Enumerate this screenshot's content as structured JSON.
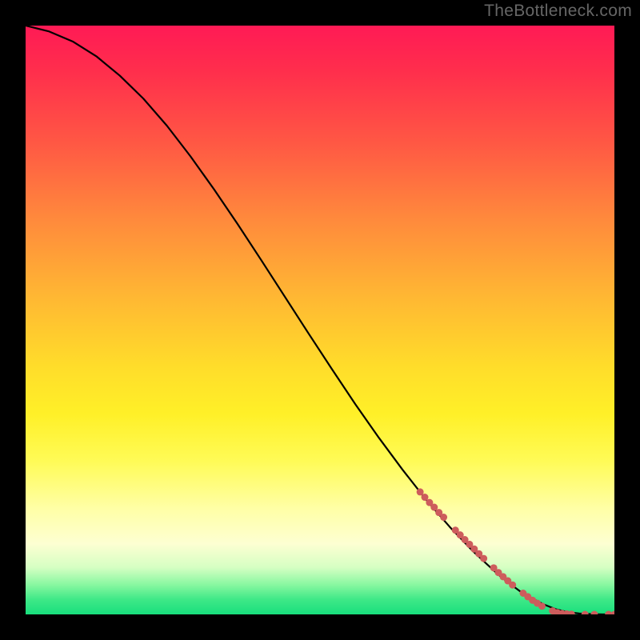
{
  "watermark": "TheBottleneck.com",
  "colors": {
    "page_bg": "#000000",
    "curve": "#000000",
    "marker_fill": "#cd5c5c",
    "marker_stroke": "#cd5c5c"
  },
  "chart_data": {
    "type": "line",
    "title": "",
    "xlabel": "",
    "ylabel": "",
    "xlim": [
      0,
      100
    ],
    "ylim": [
      0,
      100
    ],
    "grid": false,
    "series": [
      {
        "name": "curve",
        "x": [
          0,
          4,
          8,
          12,
          16,
          20,
          24,
          28,
          32,
          36,
          40,
          44,
          48,
          52,
          56,
          60,
          64,
          68,
          72,
          76,
          80,
          82,
          84,
          86,
          88,
          90,
          92,
          94,
          96,
          98,
          100
        ],
        "y": [
          100,
          99,
          97.3,
          94.8,
          91.5,
          87.6,
          83.0,
          77.8,
          72.2,
          66.3,
          60.2,
          54.0,
          47.8,
          41.7,
          35.7,
          30.0,
          24.6,
          19.5,
          14.9,
          10.7,
          7.0,
          5.4,
          3.9,
          2.7,
          1.7,
          0.9,
          0.4,
          0.15,
          0.05,
          0,
          0
        ]
      }
    ],
    "markers": [
      {
        "x": 67.0,
        "y": 20.8
      },
      {
        "x": 67.8,
        "y": 19.9
      },
      {
        "x": 68.6,
        "y": 19.0
      },
      {
        "x": 69.4,
        "y": 18.2
      },
      {
        "x": 70.2,
        "y": 17.3
      },
      {
        "x": 71.0,
        "y": 16.5
      },
      {
        "x": 73.0,
        "y": 14.3
      },
      {
        "x": 73.8,
        "y": 13.5
      },
      {
        "x": 74.6,
        "y": 12.7
      },
      {
        "x": 75.4,
        "y": 11.9
      },
      {
        "x": 76.2,
        "y": 11.1
      },
      {
        "x": 77.0,
        "y": 10.3
      },
      {
        "x": 77.8,
        "y": 9.5
      },
      {
        "x": 79.5,
        "y": 7.9
      },
      {
        "x": 80.3,
        "y": 7.1
      },
      {
        "x": 81.1,
        "y": 6.4
      },
      {
        "x": 81.9,
        "y": 5.7
      },
      {
        "x": 82.7,
        "y": 5.0
      },
      {
        "x": 84.5,
        "y": 3.6
      },
      {
        "x": 85.3,
        "y": 3.0
      },
      {
        "x": 86.1,
        "y": 2.4
      },
      {
        "x": 86.9,
        "y": 1.9
      },
      {
        "x": 87.7,
        "y": 1.4
      },
      {
        "x": 89.5,
        "y": 0.6
      },
      {
        "x": 90.3,
        "y": 0.3
      },
      {
        "x": 91.1,
        "y": 0.15
      },
      {
        "x": 91.9,
        "y": 0.08
      },
      {
        "x": 92.7,
        "y": 0.04
      },
      {
        "x": 95.0,
        "y": 0.0
      },
      {
        "x": 96.6,
        "y": 0.0
      },
      {
        "x": 99.0,
        "y": 0.0
      },
      {
        "x": 100.0,
        "y": 0.0
      }
    ],
    "marker_style": {
      "shape": "circle",
      "size": 9,
      "color": "#cd5c5c"
    }
  }
}
